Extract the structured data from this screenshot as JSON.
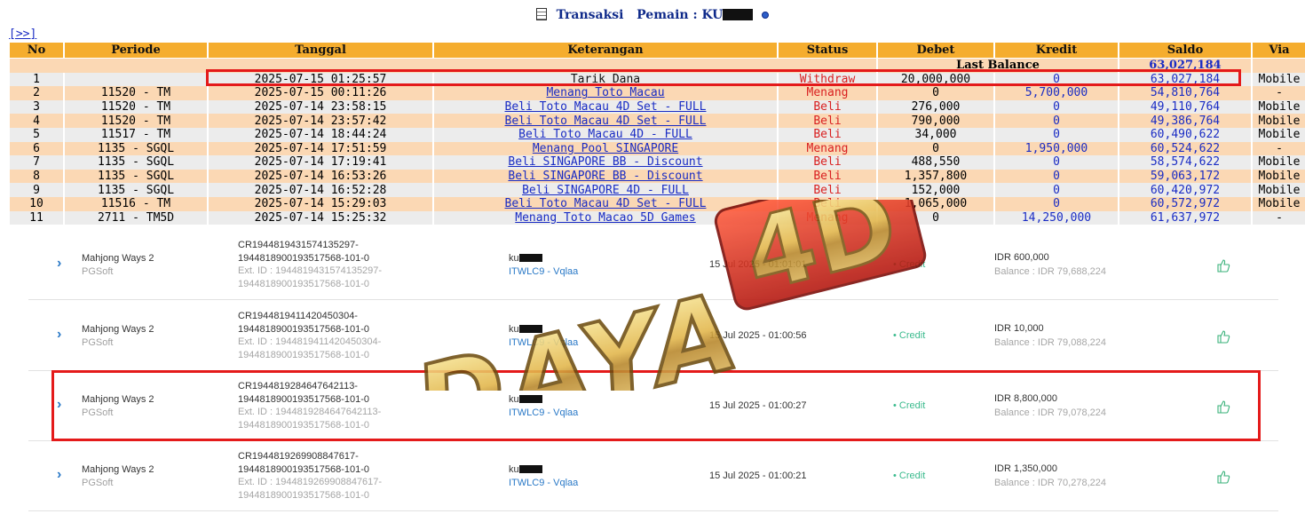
{
  "header": {
    "title_prefix": "Transaksi",
    "title_label": "Pemain : KU",
    "nav_next": "[>>]"
  },
  "table": {
    "columns": [
      "No",
      "Periode",
      "Tanggal",
      "Keterangan",
      "Status",
      "Debet",
      "Kredit",
      "Saldo",
      "Via"
    ],
    "last_balance_label": "Last Balance",
    "last_balance_value": "63,027,184",
    "rows": [
      {
        "no": "1",
        "periode": "",
        "tanggal": "2025-07-15 01:25:57",
        "keterangan": "Tarik Dana",
        "status": "Withdraw",
        "debet": "20,000,000",
        "kredit": "0",
        "saldo": "63,027,184",
        "via": "Mobile"
      },
      {
        "no": "2",
        "periode": "11520 - TM",
        "tanggal": "2025-07-15 00:11:26",
        "keterangan": "Menang Toto Macau",
        "status": "Menang",
        "debet": "0",
        "kredit": "5,700,000",
        "saldo": "54,810,764",
        "via": "-"
      },
      {
        "no": "3",
        "periode": "11520 - TM",
        "tanggal": "2025-07-14 23:58:15",
        "keterangan": "Beli Toto Macau 4D Set - FULL",
        "status": "Beli",
        "debet": "276,000",
        "kredit": "0",
        "saldo": "49,110,764",
        "via": "Mobile"
      },
      {
        "no": "4",
        "periode": "11520 - TM",
        "tanggal": "2025-07-14 23:57:42",
        "keterangan": "Beli Toto Macau 4D Set - FULL",
        "status": "Beli",
        "debet": "790,000",
        "kredit": "0",
        "saldo": "49,386,764",
        "via": "Mobile"
      },
      {
        "no": "5",
        "periode": "11517 - TM",
        "tanggal": "2025-07-14 18:44:24",
        "keterangan": "Beli Toto Macau 4D - FULL",
        "status": "Beli",
        "debet": "34,000",
        "kredit": "0",
        "saldo": "60,490,622",
        "via": "Mobile"
      },
      {
        "no": "6",
        "periode": "1135 - SGQL",
        "tanggal": "2025-07-14 17:51:59",
        "keterangan": "Menang Pool SINGAPORE",
        "status": "Menang",
        "debet": "0",
        "kredit": "1,950,000",
        "saldo": "60,524,622",
        "via": "-"
      },
      {
        "no": "7",
        "periode": "1135 - SGQL",
        "tanggal": "2025-07-14 17:19:41",
        "keterangan": "Beli SINGAPORE BB - Discount",
        "status": "Beli",
        "debet": "488,550",
        "kredit": "0",
        "saldo": "58,574,622",
        "via": "Mobile"
      },
      {
        "no": "8",
        "periode": "1135 - SGQL",
        "tanggal": "2025-07-14 16:53:26",
        "keterangan": "Beli SINGAPORE BB - Discount",
        "status": "Beli",
        "debet": "1,357,800",
        "kredit": "0",
        "saldo": "59,063,172",
        "via": "Mobile"
      },
      {
        "no": "9",
        "periode": "1135 - SGQL",
        "tanggal": "2025-07-14 16:52:28",
        "keterangan": "Beli SINGAPORE 4D - FULL",
        "status": "Beli",
        "debet": "152,000",
        "kredit": "0",
        "saldo": "60,420,972",
        "via": "Mobile"
      },
      {
        "no": "10",
        "periode": "11516 - TM",
        "tanggal": "2025-07-14 15:29:03",
        "keterangan": "Beli Toto Macau 4D Set - FULL",
        "status": "Beli",
        "debet": "1,065,000",
        "kredit": "0",
        "saldo": "60,572,972",
        "via": "Mobile"
      },
      {
        "no": "11",
        "periode": "2711 - TM5D",
        "tanggal": "2025-07-14 15:25:32",
        "keterangan": "Menang Toto Macao 5D Games",
        "status": "Menang",
        "debet": "0",
        "kredit": "14,250,000",
        "saldo": "61,637,972",
        "via": "-"
      }
    ]
  },
  "game_log": [
    {
      "game": "Mahjong Ways 2",
      "provider": "PGSoft",
      "ref_line1": "CR194481943157413529­7-",
      "ref_line2": "194481890019351756­8-101-0",
      "ext_line1": "Ext. ID : 1944819431574135297-",
      "ext_line2": "194481890019351756­8-101-0",
      "user": "ku",
      "agent": "ITWLC9 - Vqlaa",
      "date": "15 Jul 2025 - 01:01:01",
      "type": "Credit",
      "amount": "IDR 600,000",
      "balance": "Balance : IDR 79,688,224"
    },
    {
      "game": "Mahjong Ways 2",
      "provider": "PGSoft",
      "ref_line1": "CR1944819411420450304-",
      "ref_line2": "194481890019351756­8-101-0",
      "ext_line1": "Ext. ID : 1944819411420450304-",
      "ext_line2": "194481890019351756­8-101-0",
      "user": "ku",
      "agent": "ITWLC9 - Vqlaa",
      "date": "15 Jul 2025 - 01:00:56",
      "type": "Credit",
      "amount": "IDR 10,000",
      "balance": "Balance : IDR 79,088,224"
    },
    {
      "game": "Mahjong Ways 2",
      "provider": "PGSoft",
      "ref_line1": "CR1944819284647642113-",
      "ref_line2": "194481890019351756­8-101-0",
      "ext_line1": "Ext. ID : 1944819284647642113-",
      "ext_line2": "194481890019351756­8-101-0",
      "user": "ku",
      "agent": "ITWLC9 - Vqlaa",
      "date": "15 Jul 2025 - 01:00:27",
      "type": "Credit",
      "amount": "IDR 8,800,000",
      "balance": "Balance : IDR 79,078,224"
    },
    {
      "game": "Mahjong Ways 2",
      "provider": "PGSoft",
      "ref_line1": "CR1944819269908847617-",
      "ref_line2": "194481890019351756­8-101-0",
      "ext_line1": "Ext. ID : 1944819269908847617-",
      "ext_line2": "194481890019351756­8-101-0",
      "user": "ku",
      "agent": "ITWLC9 - Vqlaa",
      "date": "15 Jul 2025 - 01:00:21",
      "type": "Credit",
      "amount": "IDR 1,350,000",
      "balance": "Balance : IDR 70,278,224"
    }
  ],
  "watermark": {
    "text": "DAYA",
    "badge": "4D"
  },
  "colors": {
    "header_orange": "#f5ad2e",
    "row_peach": "#fbd8b4",
    "row_gray": "#ececec",
    "link_blue": "#1a2cc4",
    "status_red": "#d92020",
    "highlight_red": "#e41a1a",
    "credit_green": "#3bbb8e"
  }
}
